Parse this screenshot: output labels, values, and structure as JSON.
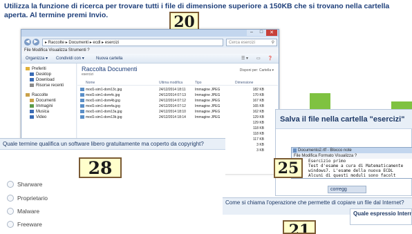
{
  "q20": {
    "text": "Utilizza la funzione di ricerca per trovare tutti i file di dimensione superiore a 150KB che si trovano nella cartella aperta. Al termine premi Invio.",
    "number": "20"
  },
  "explorer": {
    "address": "▸ Raccolte ▸ Documenti ▸ ecdl ▸ esercizi",
    "search_placeholder": "Cerca esercizi",
    "menu": "File   Modifica   Visualizza   Strumenti   ?",
    "toolbar": {
      "organize": "Organizza ▾",
      "share": "Condividi con ▾",
      "new_folder": "Nuova cartella"
    },
    "nav": [
      {
        "label": "Preferiti",
        "color": "#e0b13a"
      },
      {
        "label": "Desktop",
        "color": "#3a6bb5"
      },
      {
        "label": "Download",
        "color": "#3a6bb5"
      },
      {
        "label": "Risorse recenti",
        "color": "#8a8a8a"
      },
      {
        "label": "Raccolte",
        "color": "#c9a14a"
      },
      {
        "label": "Documenti",
        "color": "#c9a14a"
      },
      {
        "label": "Immagini",
        "color": "#5a9a4a"
      },
      {
        "label": "Musica",
        "color": "#3a6bb5"
      },
      {
        "label": "Video",
        "color": "#3a6bb5"
      }
    ],
    "library_title": "Raccolta Documenti",
    "library_sub": "esercizi",
    "arrange": "Disponi per:  Cartella ▾",
    "columns": [
      "Nome",
      "Ultima modifica",
      "Tipo",
      "Dimensione"
    ],
    "files": [
      {
        "name": "mod1-sim1-dom13c.jpg",
        "date": "24/12/2014 18:11",
        "type": "Immagine JPEG",
        "size": "182 KB"
      },
      {
        "name": "mod1-sim1-dom4c.jpg",
        "date": "24/12/2014 07:13",
        "type": "Immagine JPEG",
        "size": "170 KB"
      },
      {
        "name": "mod1-sim1-dom4b.jpg",
        "date": "24/12/2014 07:12",
        "type": "Immagine JPEG",
        "size": "167 KB"
      },
      {
        "name": "mod1-sim1-dom4a.jpg",
        "date": "24/12/2014 07:12",
        "type": "Immagine JPEG",
        "size": "165 KB"
      },
      {
        "name": "mod1-sim1-dom13a.jpg",
        "date": "24/12/2014 18:10",
        "type": "Immagine JPEG",
        "size": "162 KB"
      },
      {
        "name": "mod1-sim1-dom13b.jpg",
        "date": "24/12/2014 18:14",
        "type": "Immagine JPEG",
        "size": "129 KB"
      },
      {
        "name": "",
        "date": "",
        "type": "",
        "size": "129 KB"
      },
      {
        "name": "",
        "date": "",
        "type": "",
        "size": "118 KB"
      },
      {
        "name": "",
        "date": "",
        "type": "",
        "size": "118 KB"
      },
      {
        "name": "",
        "date": "",
        "type": "",
        "size": "117 KB"
      },
      {
        "name": "",
        "date": "",
        "type": "",
        "size": "3 KB"
      },
      {
        "name": "",
        "date": "",
        "type": "",
        "size": "3 KB"
      }
    ]
  },
  "q28": {
    "question": "Quale termine qualifica un software libero gratuitamente ma coperto da copyright?",
    "number": "28",
    "options": [
      "Sharware",
      "Proprietario",
      "Malware",
      "Freeware"
    ]
  },
  "q25": {
    "question": "Salva il file nella cartella \"esercizi\"",
    "number": "25",
    "notepad_title": "Documento2.rtf - Blocco note",
    "notepad_menu": "File  Modifica  Formato  Visualizza  ?",
    "notepad_lines": [
      "Esercizio primo",
      "Test d'esame a cura di Matematicamente",
      "windows7. L'esame della nuova ECDL",
      "Alcuni di questi moduli sono facolt"
    ],
    "button": "corregg"
  },
  "q21": {
    "question": "Come si chiama l'operazione che permette di copiare un file dal Internet?",
    "number": "21",
    "side_question": "Quale espressio Internet?"
  }
}
